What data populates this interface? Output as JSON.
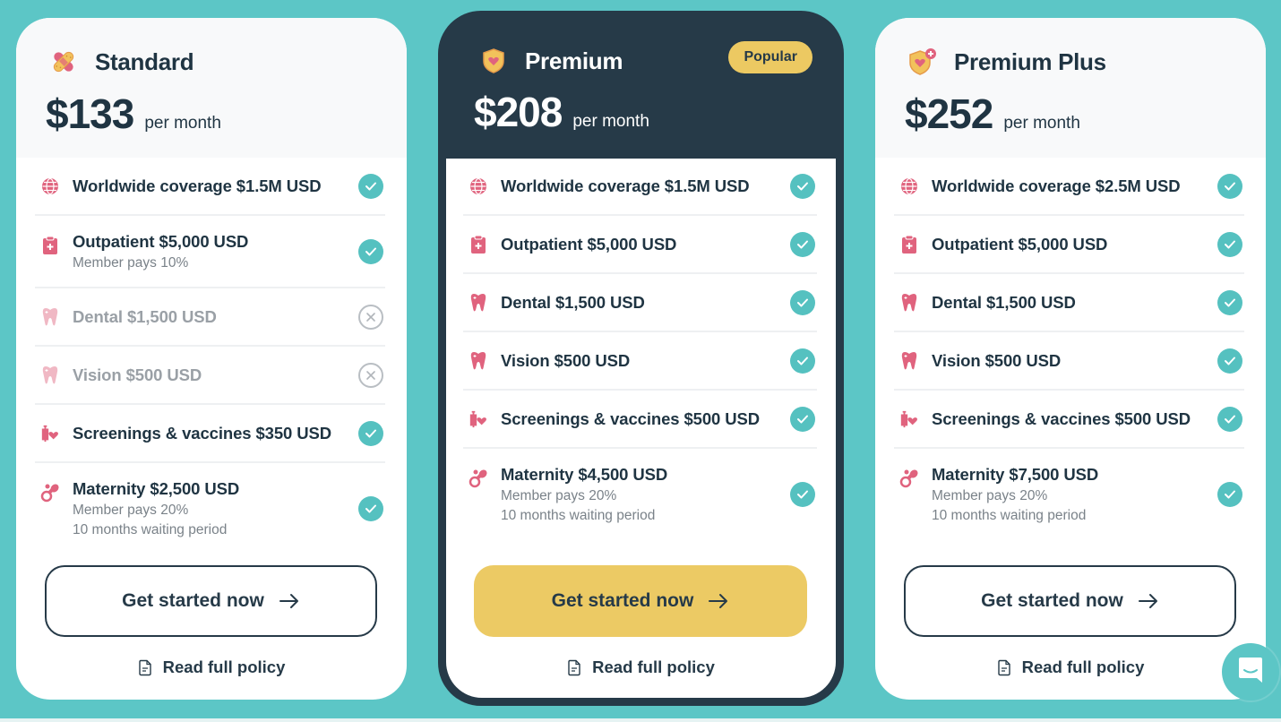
{
  "colors": {
    "background": "#5cc6c6",
    "dark": "#263a48",
    "accent_yellow": "#ecca64",
    "check_teal": "#55c1c0",
    "icon_pink": "#e0637e"
  },
  "plans": [
    {
      "name": "Standard",
      "icon": "bandage-icon",
      "price": "$133",
      "period": "per month",
      "features": [
        {
          "icon": "globe-icon",
          "title": "Worldwide coverage $1.5M USD",
          "subs": [],
          "included": true
        },
        {
          "icon": "clipboard-medical-icon",
          "title": "Outpatient $5,000 USD",
          "subs": [
            "Member pays 10%"
          ],
          "included": true
        },
        {
          "icon": "tooth-icon",
          "title": "Dental $1,500 USD",
          "subs": [],
          "included": false
        },
        {
          "icon": "tooth-icon",
          "title": "Vision $500 USD",
          "subs": [],
          "included": false
        },
        {
          "icon": "syringe-heart-icon",
          "title": "Screenings & vaccines $350 USD",
          "subs": [],
          "included": true
        },
        {
          "icon": "baby-pacifier-icon",
          "title": "Maternity $2,500 USD",
          "subs": [
            "Member pays 20%",
            "10 months waiting period"
          ],
          "included": true
        }
      ],
      "cta_label": "Get started now",
      "policy_label": "Read full policy"
    },
    {
      "name": "Premium",
      "icon": "shield-heart-icon",
      "badge": "Popular",
      "price": "$208",
      "period": "per month",
      "features": [
        {
          "icon": "globe-icon",
          "title": "Worldwide coverage $1.5M USD",
          "subs": [],
          "included": true
        },
        {
          "icon": "clipboard-medical-icon",
          "title": "Outpatient $5,000 USD",
          "subs": [],
          "included": true
        },
        {
          "icon": "tooth-icon",
          "title": "Dental $1,500 USD",
          "subs": [],
          "included": true
        },
        {
          "icon": "tooth-icon",
          "title": "Vision $500 USD",
          "subs": [],
          "included": true
        },
        {
          "icon": "syringe-heart-icon",
          "title": "Screenings & vaccines $500 USD",
          "subs": [],
          "included": true
        },
        {
          "icon": "baby-pacifier-icon",
          "title": "Maternity $4,500 USD",
          "subs": [
            "Member pays 20%",
            "10 months waiting period"
          ],
          "included": true
        }
      ],
      "cta_label": "Get started now",
      "policy_label": "Read full policy"
    },
    {
      "name": "Premium Plus",
      "icon": "shield-heart-plus-icon",
      "price": "$252",
      "period": "per month",
      "features": [
        {
          "icon": "globe-icon",
          "title": "Worldwide coverage $2.5M USD",
          "subs": [],
          "included": true
        },
        {
          "icon": "clipboard-medical-icon",
          "title": "Outpatient $5,000 USD",
          "subs": [],
          "included": true
        },
        {
          "icon": "tooth-icon",
          "title": "Dental $1,500 USD",
          "subs": [],
          "included": true
        },
        {
          "icon": "tooth-icon",
          "title": "Vision $500 USD",
          "subs": [],
          "included": true
        },
        {
          "icon": "syringe-heart-icon",
          "title": "Screenings & vaccines $500 USD",
          "subs": [],
          "included": true
        },
        {
          "icon": "baby-pacifier-icon",
          "title": "Maternity $7,500 USD",
          "subs": [
            "Member pays 20%",
            "10 months waiting period"
          ],
          "included": true
        }
      ],
      "cta_label": "Get started now",
      "policy_label": "Read full policy"
    }
  ],
  "chat": {
    "icon": "chat-bubble-icon"
  }
}
